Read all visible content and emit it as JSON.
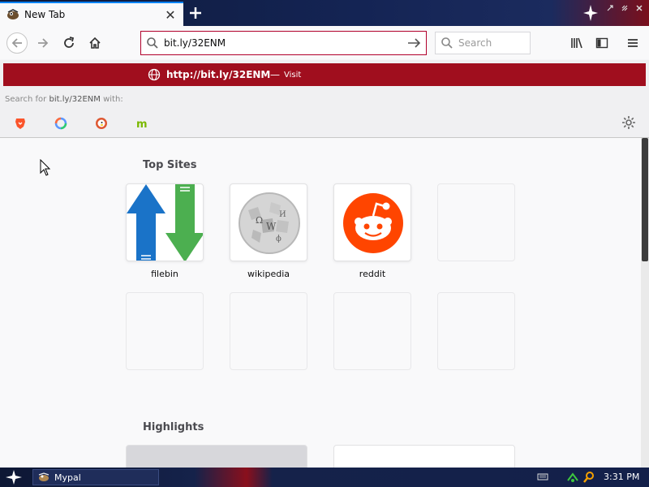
{
  "tab": {
    "title": "New Tab"
  },
  "urlbar": {
    "value": "bit.ly/32ENM"
  },
  "searchbar": {
    "placeholder": "Search"
  },
  "autocomplete": {
    "url_prefix": "http://",
    "url_bold": "bit.ly/32ENM",
    "dash": "—",
    "action": "Visit",
    "search_label_prefix": "Search for ",
    "search_query": "bit.ly/32ENM",
    "search_label_suffix": " with:",
    "engines": [
      "brave-icon",
      "qwant-icon",
      "duckduckgo-icon",
      "mojeek-icon"
    ]
  },
  "newtab": {
    "top_sites_title": "Top Sites",
    "highlights_title": "Highlights",
    "top_sites": [
      {
        "label": "filebin",
        "icon": "filebin-icon"
      },
      {
        "label": "wikipedia",
        "icon": "wikipedia-icon"
      },
      {
        "label": "reddit",
        "icon": "reddit-icon"
      }
    ]
  },
  "taskbar": {
    "task_label": "Mypal",
    "clock": "3:31 PM"
  },
  "colors": {
    "accent": "#a00e1e",
    "urlbar_border": "#b1002c",
    "titlebar": "#142454"
  }
}
